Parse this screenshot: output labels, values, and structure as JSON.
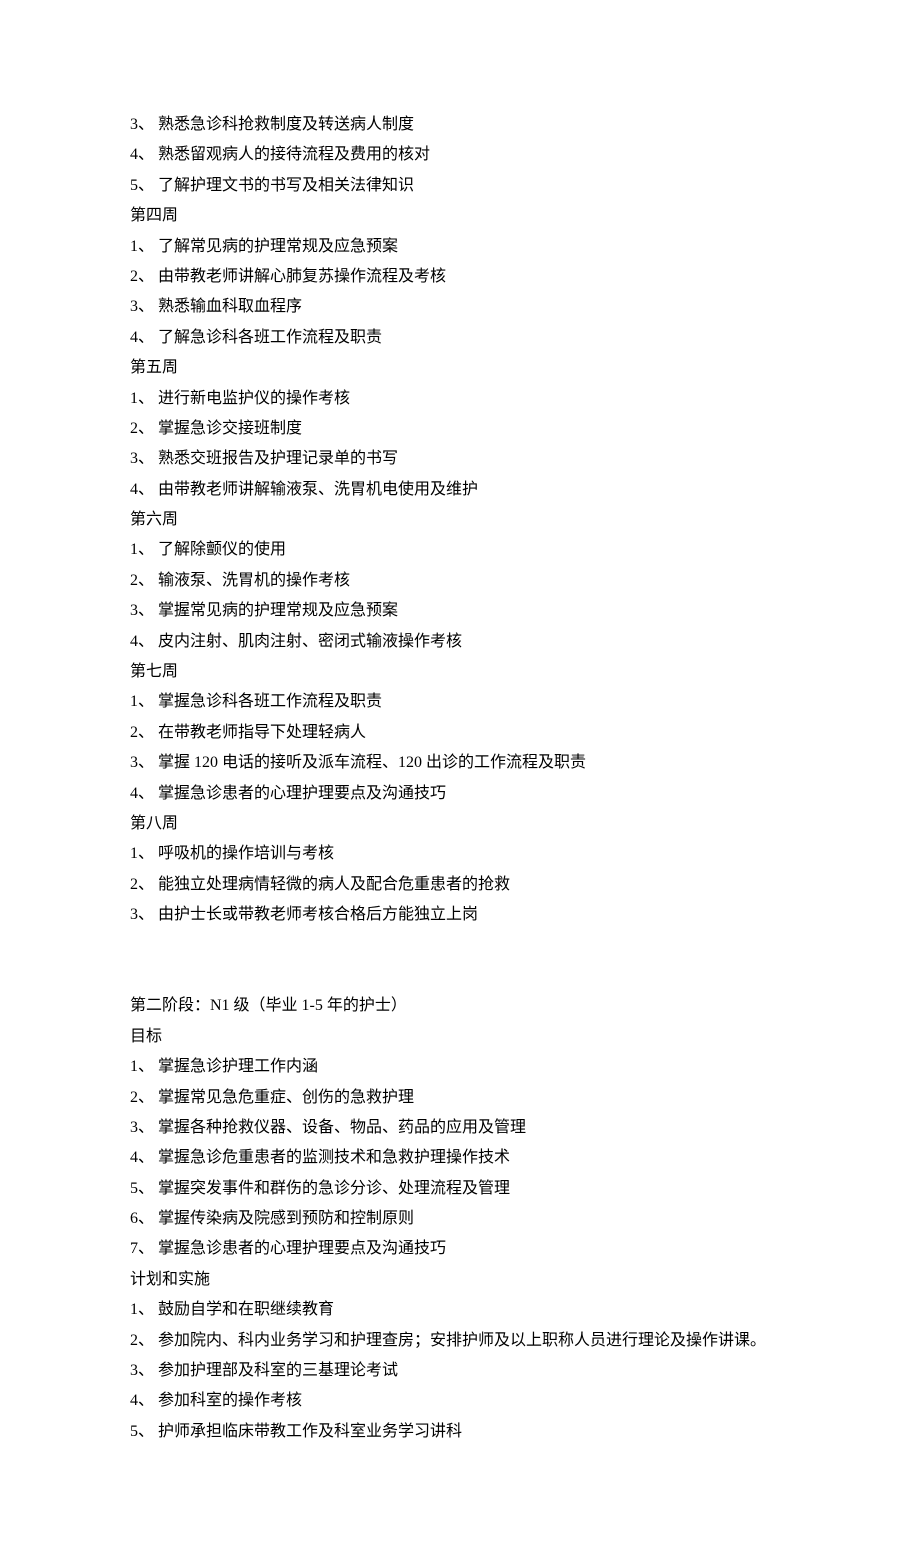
{
  "lines": [
    "3、 熟悉急诊科抢救制度及转送病人制度",
    "4、 熟悉留观病人的接待流程及费用的核对",
    "5、 了解护理文书的书写及相关法律知识",
    "第四周",
    "1、 了解常见病的护理常规及应急预案",
    "2、 由带教老师讲解心肺复苏操作流程及考核",
    "3、 熟悉输血科取血程序",
    "4、 了解急诊科各班工作流程及职责",
    "第五周",
    "1、 进行新电监护仪的操作考核",
    "2、 掌握急诊交接班制度",
    "3、 熟悉交班报告及护理记录单的书写",
    "4、 由带教老师讲解输液泵、洗胃机电使用及维护",
    "第六周",
    "1、 了解除颤仪的使用",
    "2、 输液泵、洗胃机的操作考核",
    "3、 掌握常见病的护理常规及应急预案",
    "4、 皮内注射、肌肉注射、密闭式输液操作考核",
    "第七周",
    "1、 掌握急诊科各班工作流程及职责",
    "2、 在带教老师指导下处理轻病人",
    "3、 掌握 120 电话的接听及派车流程、120 出诊的工作流程及职责",
    "4、 掌握急诊患者的心理护理要点及沟通技巧",
    "第八周",
    "1、 呼吸机的操作培训与考核",
    "2、 能独立处理病情轻微的病人及配合危重患者的抢救",
    "3、 由护士长或带教老师考核合格后方能独立上岗",
    "",
    "",
    "第二阶段：N1 级（毕业 1-5 年的护士）",
    "目标",
    "1、 掌握急诊护理工作内涵",
    "2、 掌握常见急危重症、创伤的急救护理",
    "3、 掌握各种抢救仪器、设备、物品、药品的应用及管理",
    "4、 掌握急诊危重患者的监测技术和急救护理操作技术",
    "5、 掌握突发事件和群伤的急诊分诊、处理流程及管理",
    "6、 掌握传染病及院感到预防和控制原则",
    "7、 掌握急诊患者的心理护理要点及沟通技巧",
    "计划和实施",
    "1、 鼓励自学和在职继续教育",
    "2、 参加院内、科内业务学习和护理查房；安排护师及以上职称人员进行理论及操作讲课。",
    "3、 参加护理部及科室的三基理论考试",
    "4、 参加科室的操作考核",
    "5、 护师承担临床带教工作及科室业务学习讲科"
  ]
}
